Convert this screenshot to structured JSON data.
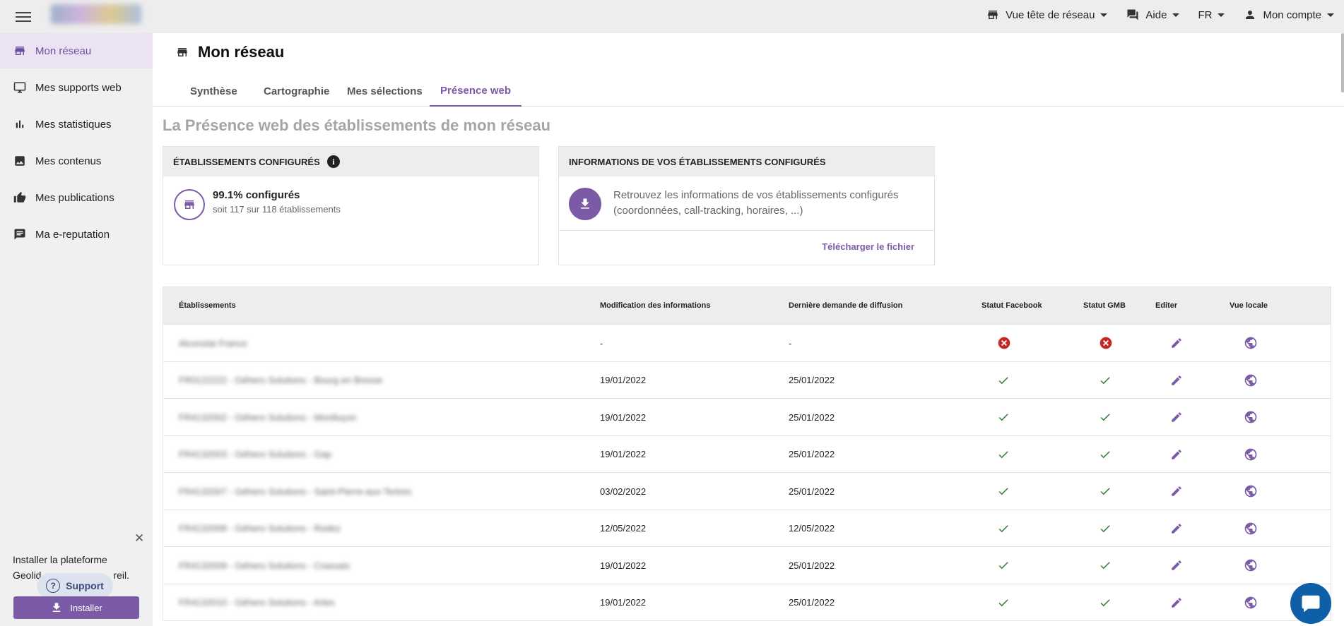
{
  "topbar": {
    "items": [
      {
        "label": "Vue tête de réseau",
        "icon": "store-icon"
      },
      {
        "label": "Aide",
        "icon": "chat-icon"
      },
      {
        "label": "FR",
        "icon": ""
      },
      {
        "label": "Mon compte",
        "icon": "person-icon"
      }
    ]
  },
  "sidebar": {
    "items": [
      {
        "label": "Mon réseau",
        "icon": "store-icon",
        "active": true
      },
      {
        "label": "Mes supports web",
        "icon": "monitor-icon",
        "active": false
      },
      {
        "label": "Mes statistiques",
        "icon": "bar-chart-icon",
        "active": false
      },
      {
        "label": "Mes contenus",
        "icon": "image-icon",
        "active": false
      },
      {
        "label": "Mes publications",
        "icon": "thumb-up-icon",
        "active": false
      },
      {
        "label": "Ma e-reputation",
        "icon": "comment-icon",
        "active": false
      }
    ],
    "install_text_1": "Installer la plateforme",
    "install_text_2": "Geolid",
    "install_text_3": "reil.",
    "support_label": "Support",
    "support_icon": "?",
    "install_label": "Installer"
  },
  "page": {
    "title": "Mon réseau",
    "tabs": [
      "Synthèse",
      "Cartographie",
      "Mes sélections",
      "Présence web"
    ],
    "active_tab": 3,
    "section_title": "La Présence web des établissements de mon réseau"
  },
  "card_configured": {
    "title": "ÉTABLISSEMENTS CONFIGURÉS",
    "info_icon": "i",
    "percent_label": "99.1% configurés",
    "detail": "soit 117 sur 118 établissements"
  },
  "card_info": {
    "title": "INFORMATIONS DE VOS ÉTABLISSEMENTS CONFIGURÉS",
    "text": "Retrouvez les informations de vos établissements configurés (coordonnées, call-tracking, horaires, ...)",
    "link": "Télécharger le fichier"
  },
  "table": {
    "headers": [
      "Établissements",
      "Modification des informations",
      "Dernière demande de diffusion",
      "Statut Facebook",
      "Statut GMB",
      "Editer",
      "Vue locale"
    ],
    "rows": [
      {
        "name": "Alconslat France",
        "modified": "-",
        "diffusion": "-",
        "facebook": "error",
        "gmb": "error"
      },
      {
        "name": "FR0122222 - Géhero Solutions - Bourg en Bresse",
        "modified": "19/01/2022",
        "diffusion": "25/01/2022",
        "facebook": "ok",
        "gmb": "ok"
      },
      {
        "name": "FR4132002 - Géhero Solutions - Montluçon",
        "modified": "19/01/2022",
        "diffusion": "25/01/2022",
        "facebook": "ok",
        "gmb": "ok"
      },
      {
        "name": "FR4132003 - Géhero Solutions - Gap",
        "modified": "19/01/2022",
        "diffusion": "25/01/2022",
        "facebook": "ok",
        "gmb": "ok"
      },
      {
        "name": "FR4132007 - Géhero Solutions - Saint-Pierre-aux-Tertres",
        "modified": "03/02/2022",
        "diffusion": "25/01/2022",
        "facebook": "ok",
        "gmb": "ok"
      },
      {
        "name": "FR4132008 - Géhero Solutions - Rodez",
        "modified": "12/05/2022",
        "diffusion": "12/05/2022",
        "facebook": "ok",
        "gmb": "ok"
      },
      {
        "name": "FR4132009 - Géhero Solutions - Crassais",
        "modified": "19/01/2022",
        "diffusion": "25/01/2022",
        "facebook": "ok",
        "gmb": "ok"
      },
      {
        "name": "FR4132010 - Géhero Solutions - Arles",
        "modified": "19/01/2022",
        "diffusion": "25/01/2022",
        "facebook": "ok",
        "gmb": "ok"
      }
    ]
  },
  "colors": {
    "accent": "#7b5aa6",
    "success": "#2e7d32",
    "error": "#c62828",
    "chat": "#0f5fa8"
  }
}
